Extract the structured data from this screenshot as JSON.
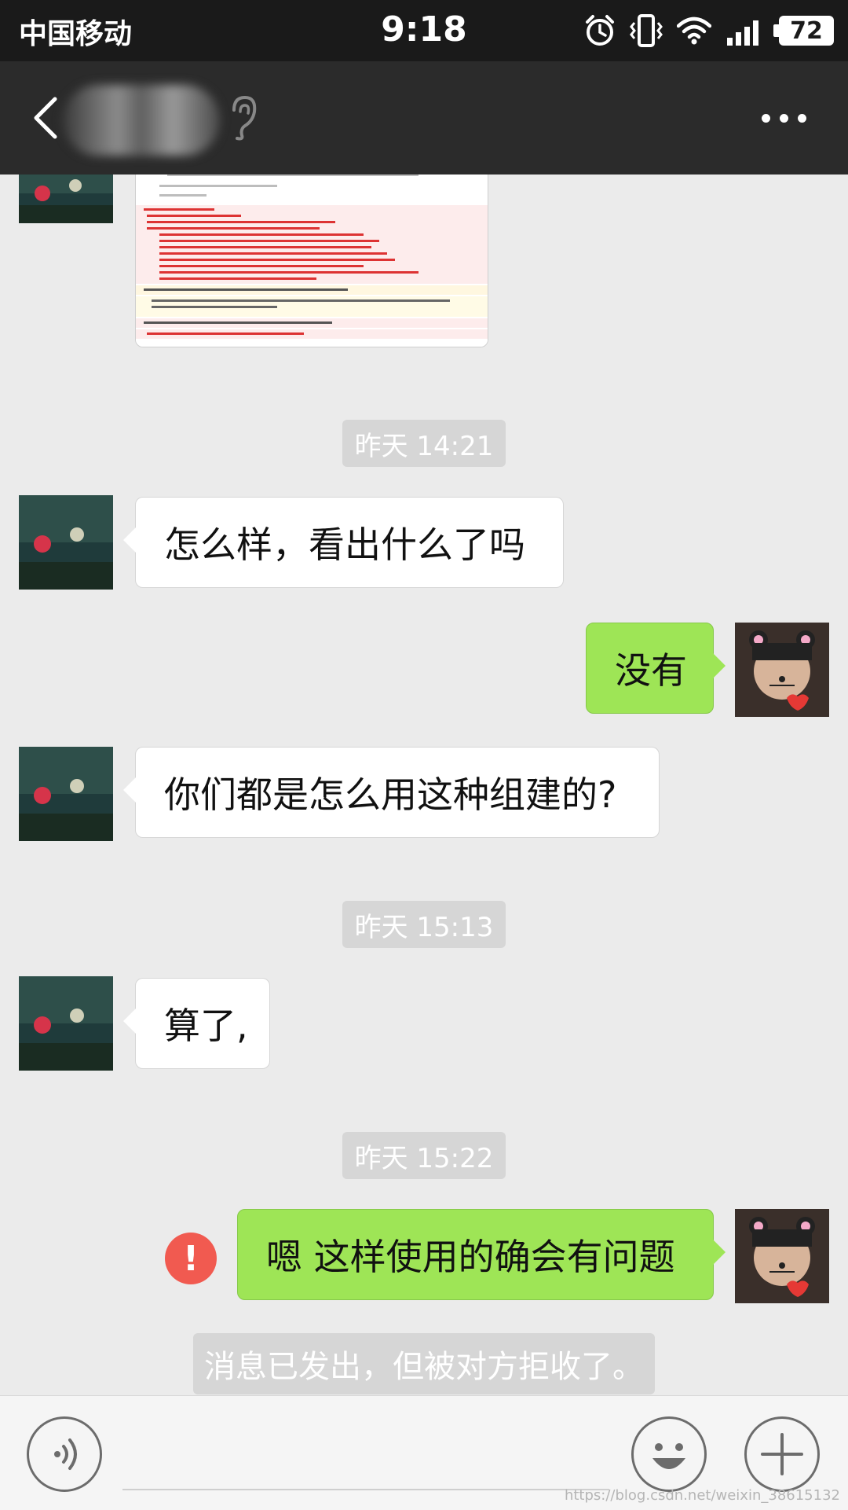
{
  "status_bar": {
    "carrier": "中国移动",
    "time": "9:18",
    "battery": "72",
    "icons": [
      "alarm-icon",
      "vibrate-icon",
      "wifi-icon",
      "signal-icon",
      "battery-icon"
    ]
  },
  "nav": {
    "back_icon": "chevron-left-icon",
    "more_icon": "more-dots-icon",
    "ear_icon": "earpiece-icon"
  },
  "messages": [
    {
      "type": "image",
      "side": "left"
    },
    {
      "type": "time",
      "text": "昨天 14:21"
    },
    {
      "type": "text",
      "side": "left",
      "text": "怎么样，看出什么了吗"
    },
    {
      "type": "text",
      "side": "right",
      "text": "没有"
    },
    {
      "type": "text",
      "side": "left",
      "text": "你们都是怎么用这种组建的?"
    },
    {
      "type": "time",
      "text": "昨天 15:13"
    },
    {
      "type": "text",
      "side": "left",
      "text": "算了,"
    },
    {
      "type": "time",
      "text": "昨天 15:22"
    },
    {
      "type": "text",
      "side": "right",
      "text": "嗯 这样使用的确会有问题",
      "failed": true
    },
    {
      "type": "system",
      "text": "消息已发出，但被对方拒收了。"
    }
  ],
  "input_bar": {
    "voice_icon": "voice-icon",
    "emoji_icon": "emoji-icon",
    "plus_icon": "plus-icon"
  },
  "watermark": "https://blog.csdn.net/weixin_38615132",
  "colors": {
    "status_bar_bg": "#1a1a1a",
    "nav_bg": "#2b2b2b",
    "chat_bg": "#ebebeb",
    "out_bubble": "#9ee556",
    "in_bubble": "#ffffff",
    "error": "#f15a50"
  }
}
